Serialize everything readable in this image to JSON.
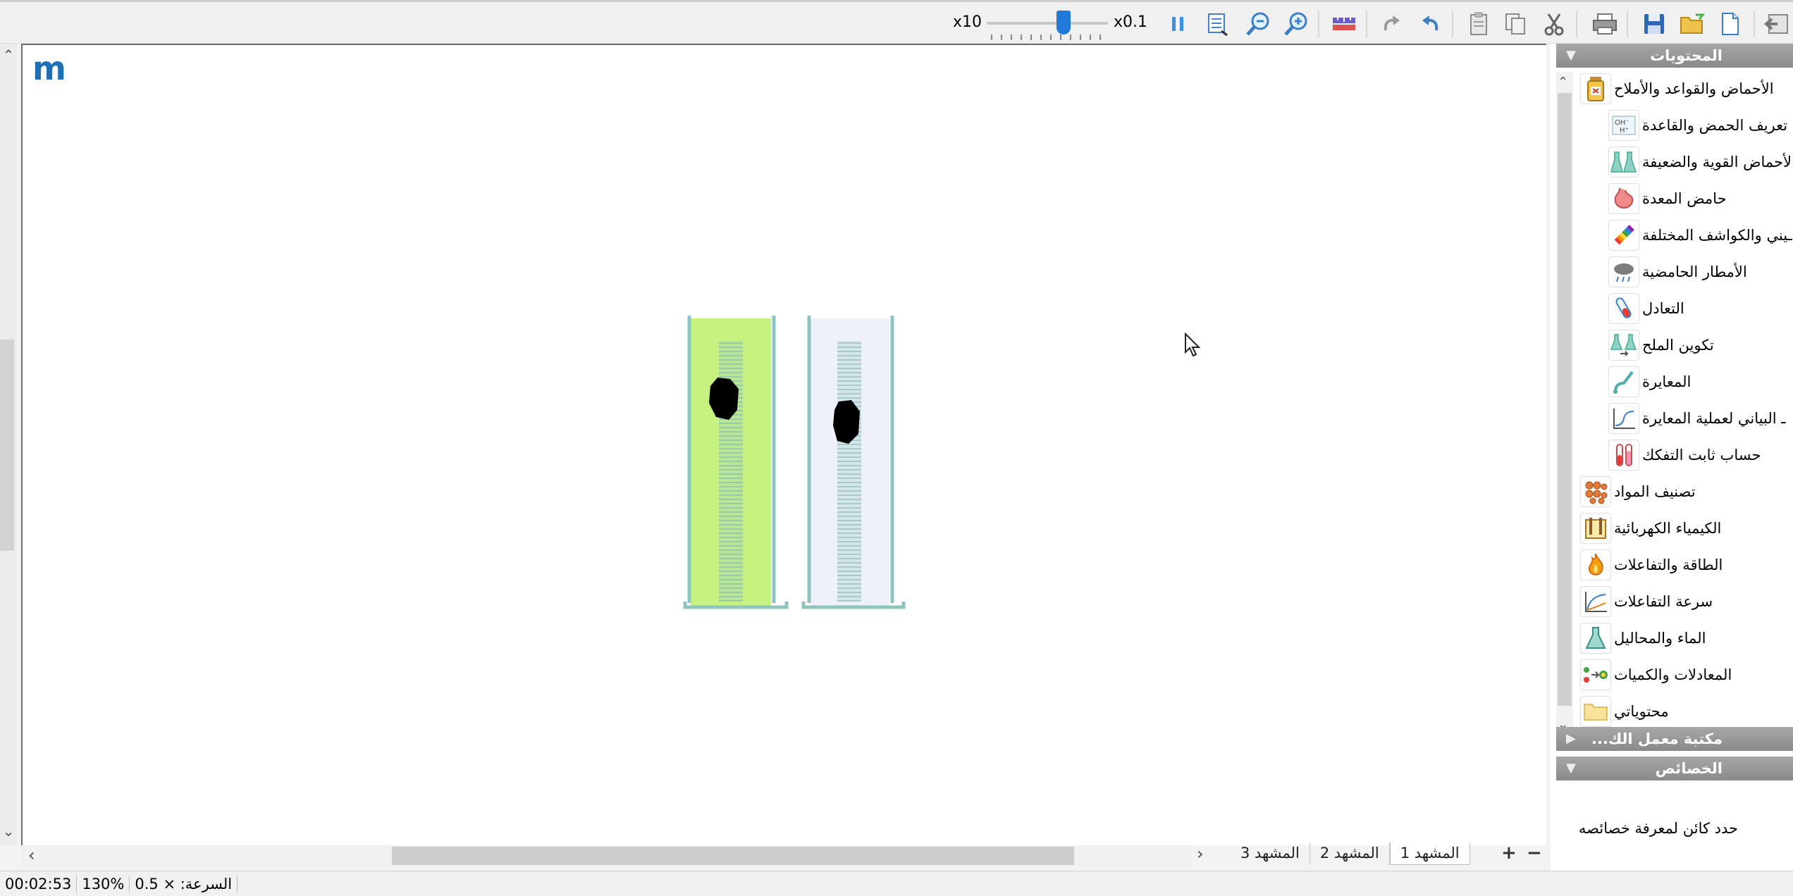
{
  "toolbar": {
    "speed_min_label": "x10",
    "speed_max_label": "x0.1",
    "speed_slider_value": 0.5,
    "icons": [
      "pause-icon",
      "fit-page-icon",
      "zoom-out-icon",
      "zoom-in-icon",
      "ruler-icon",
      "redo-icon",
      "undo-icon",
      "paste-icon",
      "copy-icon",
      "cut-icon",
      "print-icon",
      "save-icon",
      "open-folder-icon",
      "new-document-icon",
      "exit-icon"
    ]
  },
  "canvas": {
    "logo_text": "m",
    "cylinders": [
      {
        "liquid_color": "#c6f27f",
        "contents": "black-solid"
      },
      {
        "liquid_color": "#eef0fa",
        "contents": "black-solid"
      }
    ]
  },
  "scenes": {
    "tabs": [
      "المشهد 1",
      "المشهد 2",
      "المشهد 3"
    ],
    "active_index": 0,
    "add_label": "+",
    "remove_label": "−"
  },
  "status": {
    "time": "00:02:53",
    "zoom": "130%",
    "speed": "السرعة: × 0.5"
  },
  "panel": {
    "contents_header": "المحتويات",
    "library_header": "مكتبة معمل الك...",
    "properties_header": "الخصائص",
    "properties_hint": "حدد كائن لمعرفة خصائصه",
    "tree": [
      {
        "label": "الأحماض والقواعد والأملاح",
        "level": 0,
        "icon": "acid-bottle-icon"
      },
      {
        "label": "تعريف الحمض والقاعدة",
        "level": 1,
        "icon": "ion-formula-icon"
      },
      {
        "label": "الأحماض القوية والضعيفة",
        "level": 1,
        "icon": "flasks-icon"
      },
      {
        "label": "حامض المعدة",
        "level": 1,
        "icon": "stomach-icon"
      },
      {
        "label": "ـيني والكواشف المختلفة",
        "level": 1,
        "icon": "ph-strip-icon"
      },
      {
        "label": "الأمطار الحامضية",
        "level": 1,
        "icon": "rain-cloud-icon"
      },
      {
        "label": "التعادل",
        "level": 1,
        "icon": "test-tube-icon"
      },
      {
        "label": "تكوين الملح",
        "level": 1,
        "icon": "salt-flasks-icon"
      },
      {
        "label": "المعايرة",
        "level": 1,
        "icon": "burette-icon"
      },
      {
        "label": "ـ البياني لعملية المعايرة",
        "level": 1,
        "icon": "titration-curve-icon"
      },
      {
        "label": "حساب ثابت التفكك",
        "level": 1,
        "icon": "test-tubes-icon"
      },
      {
        "label": "تصنيف المواد",
        "level": 0,
        "icon": "molecules-icon"
      },
      {
        "label": "الكيمياء الكهربائية",
        "level": 0,
        "icon": "electrochem-icon"
      },
      {
        "label": "الطاقة والتفاعلات",
        "level": 0,
        "icon": "flame-icon"
      },
      {
        "label": "سرعة التفاعلات",
        "level": 0,
        "icon": "rate-graph-icon"
      },
      {
        "label": "الماء والمحاليل",
        "level": 0,
        "icon": "flask-icon"
      },
      {
        "label": "المعادلات والكميات",
        "level": 0,
        "icon": "equation-icon"
      },
      {
        "label": "محتوياتي",
        "level": 0,
        "icon": "folder-icon"
      }
    ]
  }
}
